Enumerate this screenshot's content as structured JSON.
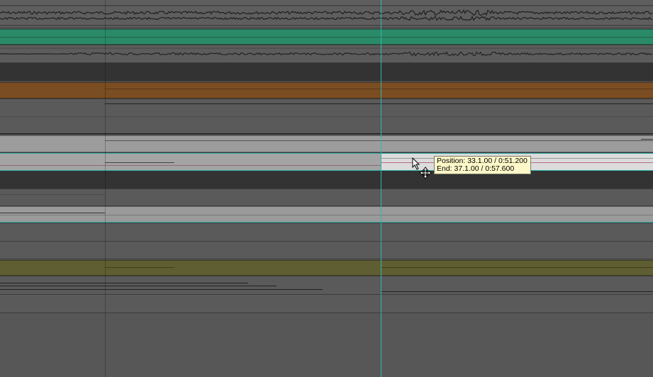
{
  "tooltip": {
    "position_label": "Position:",
    "position_value": "33.1.00 / 0:51.200",
    "end_label": "End:",
    "end_value": "37.1.00 / 0:57.600"
  },
  "colors": {
    "background": "#565656",
    "playhead": "#2fb7b1",
    "green_region": "#2a8a68",
    "orange_region": "#7a4d22",
    "olive_region": "#5f5e32",
    "grey_region": "#9c9c9c",
    "selected_region": "#dcdcdc",
    "tooltip_background": "#fff8c8"
  },
  "cursor": {
    "icon": "move-cursor-icon",
    "arrow": "arrow-pointer-icon"
  }
}
